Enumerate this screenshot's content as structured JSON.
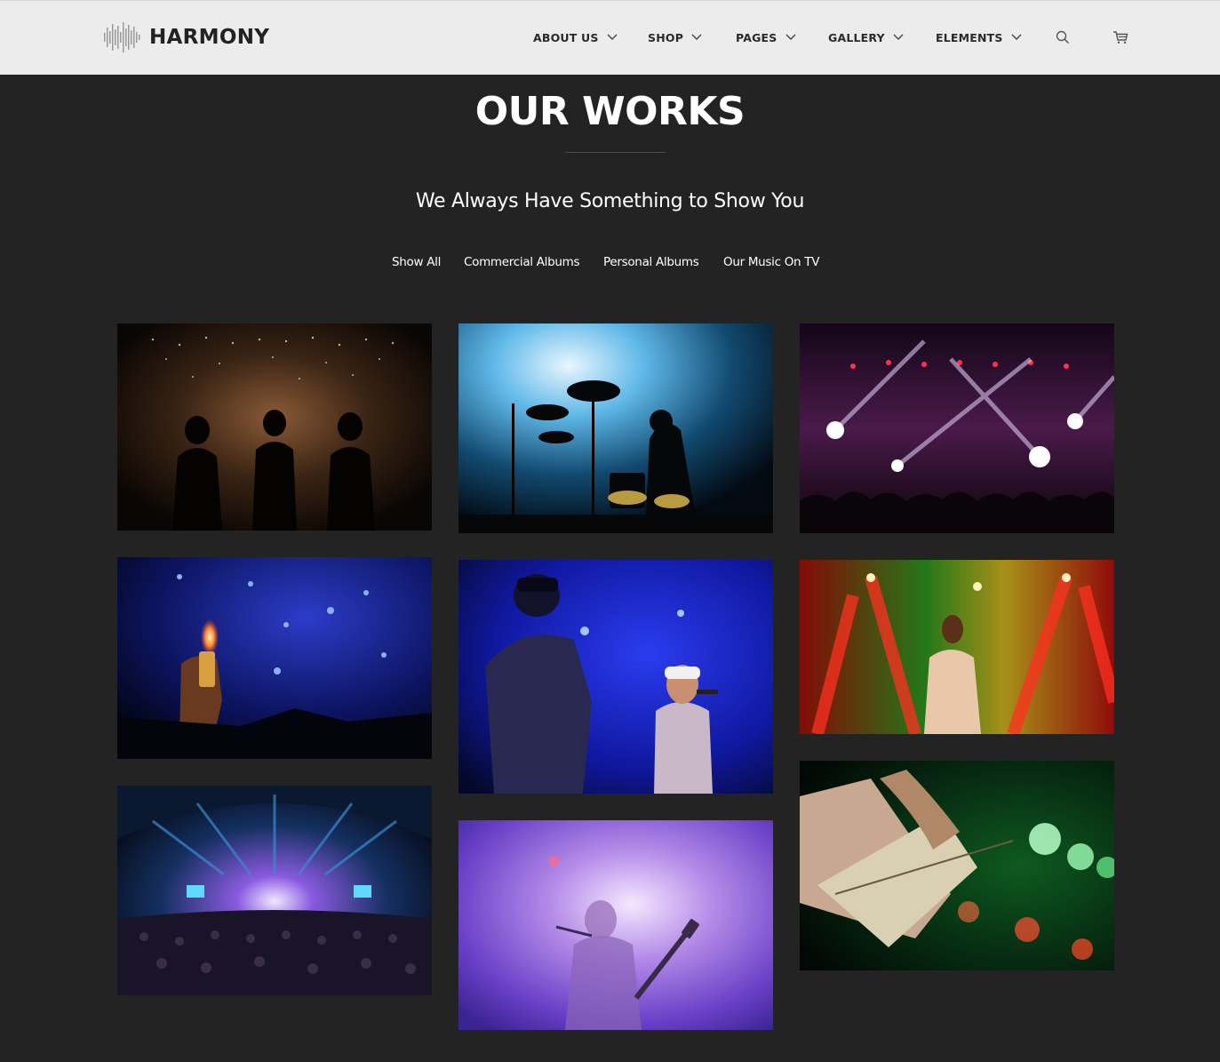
{
  "brand": {
    "name": "HARMONY"
  },
  "nav": {
    "items": [
      {
        "label": "ABOUT US"
      },
      {
        "label": "SHOP"
      },
      {
        "label": "PAGES"
      },
      {
        "label": "GALLERY"
      },
      {
        "label": "ELEMENTS"
      }
    ],
    "icons": [
      "search-icon",
      "cart-icon",
      "chevron-down-icon"
    ]
  },
  "section": {
    "title": "OUR WORKS",
    "subtitle": "We Always Have Something to Show You"
  },
  "filters": [
    {
      "label": "Show All"
    },
    {
      "label": "Commercial Albums"
    },
    {
      "label": "Personal Albums"
    },
    {
      "label": "Our Music On TV"
    }
  ],
  "colors": {
    "page_background": "#232323",
    "header_background": "#ececec",
    "text_light": "#ffffff",
    "text_dark": "#222222"
  }
}
